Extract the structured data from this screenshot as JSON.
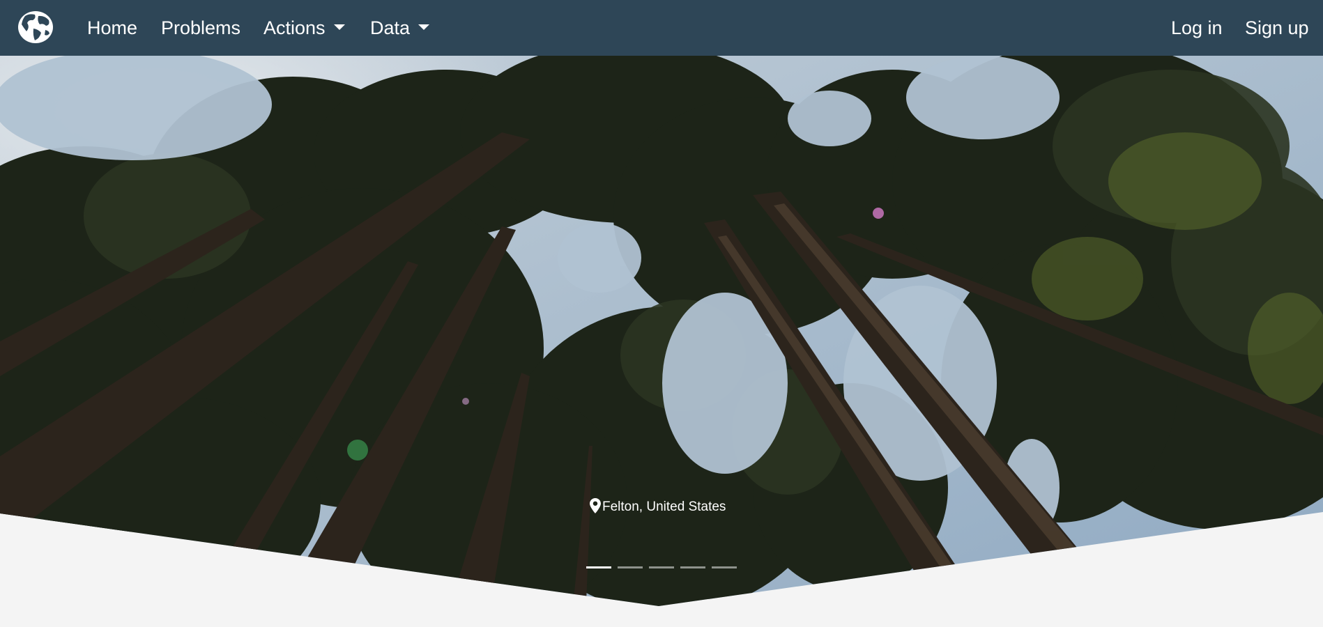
{
  "nav": {
    "logo": "globe-icon",
    "links": [
      {
        "label": "Home"
      },
      {
        "label": "Problems"
      },
      {
        "label": "Actions",
        "dropdown": true
      },
      {
        "label": "Data",
        "dropdown": true
      }
    ],
    "right": [
      {
        "label": "Log in"
      },
      {
        "label": "Sign up"
      }
    ],
    "background": "#2e4657"
  },
  "hero": {
    "image": "forest-canopy-looking-up",
    "location": "Felton, United States",
    "location_icon": "map-pin-icon",
    "slide_count": 5,
    "active_slide": 1
  },
  "page": {
    "background": "#f4f4f4"
  }
}
